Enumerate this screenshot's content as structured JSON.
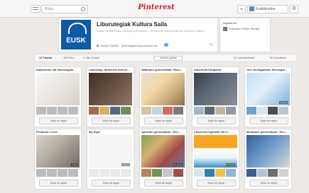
{
  "topbar": {
    "search_placeholder": "Bilatu",
    "logo": "Pinterest",
    "add": "+",
    "username": "Erabiltzailea"
  },
  "profile": {
    "avatar_text": "EUSK",
    "title": "Liburutegiak Kultura Saila",
    "description": "Eusko Jaurlaritzako Liburutegi Zerbitzua / Servicio de Bibliotecas del Gobierno Vasco",
    "location": "Vitoria-Gasteiz · liburutegiak.blog.euskadi.net"
  },
  "side": {
    "title": "Ingresa en",
    "row": "Francisco Felipe Serrabl"
  },
  "stats": {
    "boards": "12 Taulak",
    "pins": "183 Pins",
    "likes": "9 \"Me Gusta\"",
    "follow_all": "Jarraitu guztiak",
    "followers": "67 Jarraitzaileak",
    "following": "89 Jarraitzen"
  },
  "boards": [
    {
      "title": "Irakurtzeko eta liburutegiak",
      "follow": "Dejar de seguir",
      "pins": ""
    },
    {
      "title": "Liburutegi Jarduerak Interne...",
      "follow": "Dejar de seguir",
      "pins": ""
    },
    {
      "title": "Wattsoko gomendioak: Recu...",
      "follow": "Dejar de seguir",
      "pins": ""
    },
    {
      "title": "Irakurketa Kanpaina",
      "follow": "Dejar de seguir",
      "pins": ""
    },
    {
      "title": "Orri merkagarriak: Mercagrá...",
      "follow": "Dejar de seguir",
      "pins": "5 pines"
    },
    {
      "title": "Products I Love",
      "follow": "Dejar de seguir",
      "pins": "1 pin"
    },
    {
      "title": "My Style",
      "follow": "Dejar de seguir",
      "pins": "0 pines"
    },
    {
      "title": "Aprobas gomendioak : Rec...",
      "follow": "Dejar de seguir",
      "pins": "20 pines"
    },
    {
      "title": "Liburuzen egunelik eta li...",
      "follow": "Dejar de seguir",
      "pins": "16 pines"
    },
    {
      "title": "Musikako gomendioak : Rec...",
      "follow": "Dejar de seguir",
      "pins": ""
    }
  ]
}
